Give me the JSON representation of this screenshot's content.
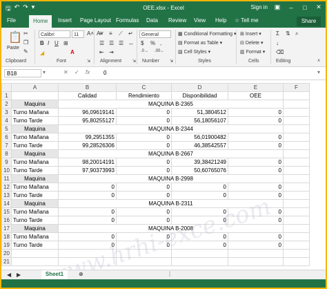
{
  "window": {
    "title": "OEE.xlsx  -  Excel",
    "signin": "Sign in"
  },
  "tabs": [
    "File",
    "Home",
    "Insert",
    "Page Layout",
    "Formulas",
    "Data",
    "Review",
    "View",
    "Help"
  ],
  "tell_me": "Tell me",
  "share": "Share",
  "ribbon": {
    "paste": "Paste",
    "font_name": "Calibri",
    "font_size": "11",
    "number_format": "General",
    "conditional_formatting": "Conditional Formatting",
    "format_as_table": "Format as Table",
    "cell_styles": "Cell Styles",
    "insert": "Insert",
    "delete": "Delete",
    "format": "Format",
    "groups": {
      "clipboard": "Clipboard",
      "font": "Font",
      "alignment": "Alignment",
      "number": "Number",
      "styles": "Styles",
      "cells": "Cells",
      "editing": "Editing"
    }
  },
  "formula_bar": {
    "name_box": "B18",
    "formula": "0"
  },
  "columns": [
    "A",
    "B",
    "C",
    "D",
    "E",
    "F"
  ],
  "rows": [
    {
      "n": "1",
      "a": "",
      "b": "Calidad",
      "c": "Rendimiento",
      "d": "Disponibilidad",
      "e": "OEE"
    },
    {
      "n": "2",
      "a": "Maquina",
      "merged": "MAQUINA B-2365"
    },
    {
      "n": "3",
      "a": "Turno Mañana",
      "b": "96,09619141",
      "c": "0",
      "d": "51,3804512",
      "e": "0"
    },
    {
      "n": "4",
      "a": "Turno Tarde",
      "b": "95,80255127",
      "c": "0",
      "d": "56,18056107",
      "e": "0"
    },
    {
      "n": "5",
      "a": "Maquina",
      "merged": "MAQUINA B-2344"
    },
    {
      "n": "6",
      "a": "Turno Mañana",
      "b": "99,2951355",
      "c": "0",
      "d": "56,01900482",
      "e": "0"
    },
    {
      "n": "7",
      "a": "Turno Tarde",
      "b": "99,28526306",
      "c": "0",
      "d": "46,38542557",
      "e": "0"
    },
    {
      "n": "8",
      "a": "Maquina",
      "merged": "MAQUINA B-2667"
    },
    {
      "n": "9",
      "a": "Turno Mañana",
      "b": "98,20014191",
      "c": "0",
      "d": "39,38421249",
      "e": "0"
    },
    {
      "n": "10",
      "a": "Turno Tarde",
      "b": "97,90373993",
      "c": "0",
      "d": "50,60765076",
      "e": "0"
    },
    {
      "n": "11",
      "a": "Maquina",
      "merged": "MAQUINA B-2998"
    },
    {
      "n": "12",
      "a": "Turno Mañana",
      "b": "0",
      "c": "0",
      "d": "0",
      "e": "0"
    },
    {
      "n": "13",
      "a": "Turno Tarde",
      "b": "0",
      "c": "0",
      "d": "0",
      "e": "0"
    },
    {
      "n": "14",
      "a": "Maquina",
      "merged": "MAQUINA B-2311"
    },
    {
      "n": "15",
      "a": "Turno Mañana",
      "b": "0",
      "c": "0",
      "d": "0",
      "e": "0"
    },
    {
      "n": "16",
      "a": "Turno Tarde",
      "b": "0",
      "c": "0",
      "d": "0",
      "e": "0"
    },
    {
      "n": "17",
      "a": "Maquina",
      "merged": "MAQUINA B-2008"
    },
    {
      "n": "18",
      "a": "Turno Mañana",
      "b": "0",
      "c": "0",
      "d": "0",
      "e": "0"
    },
    {
      "n": "19",
      "a": "Turno Tarde",
      "b": "0",
      "c": "0",
      "d": "0",
      "e": "0"
    },
    {
      "n": "20",
      "a": "",
      "b": "",
      "c": "",
      "d": "",
      "e": ""
    },
    {
      "n": "21",
      "a": "",
      "b": "",
      "c": "",
      "d": "",
      "e": ""
    }
  ],
  "sheet_tab": "Sheet1",
  "colors": {
    "excel_green": "#217346",
    "frame": "#f8b500"
  }
}
